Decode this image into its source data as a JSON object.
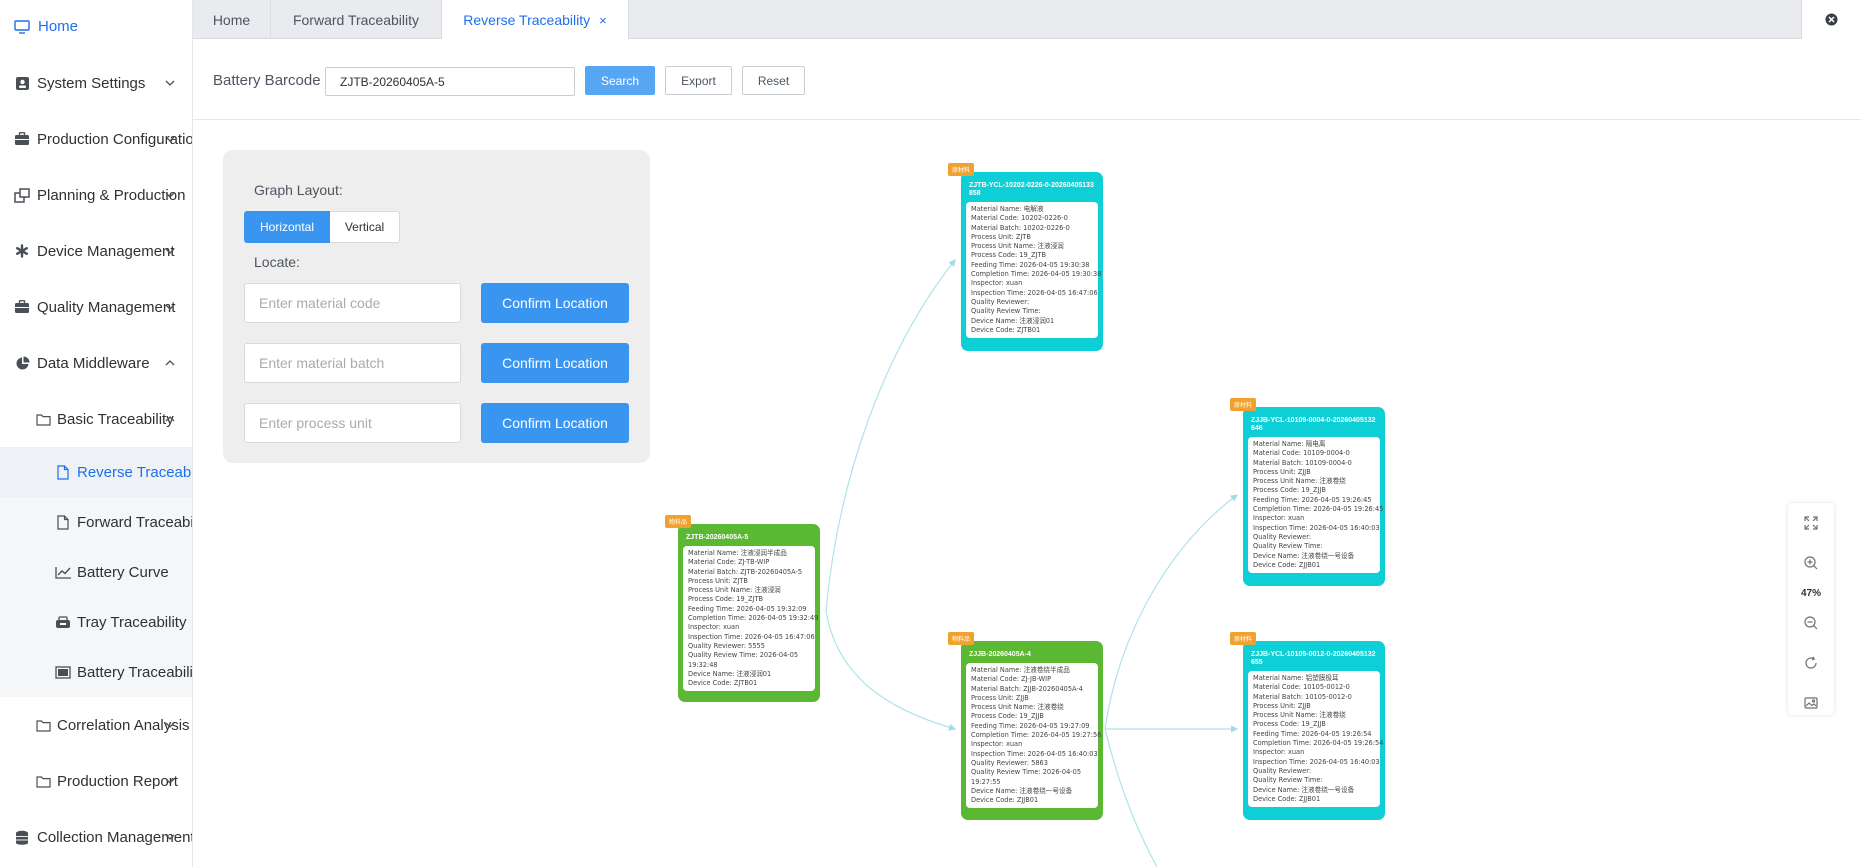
{
  "sidebar": {
    "home": "Home",
    "items": [
      {
        "label": "System Settings",
        "icon": "user-badge-icon"
      },
      {
        "label": "Production Configuration",
        "icon": "briefcase-icon"
      },
      {
        "label": "Planning & Production",
        "icon": "windows-icon"
      },
      {
        "label": "Device Management",
        "icon": "asterisk-icon"
      },
      {
        "label": "Quality Management",
        "icon": "briefcase-icon"
      },
      {
        "label": "Data Middleware",
        "icon": "pie-chart-icon"
      }
    ],
    "basic_traceability": "Basic Traceability",
    "leaves": [
      {
        "label": "Reverse Traceability",
        "active": true
      },
      {
        "label": "Forward Traceability",
        "active": false
      },
      {
        "label": "Battery Curve",
        "active": false
      },
      {
        "label": "Tray Traceability",
        "active": false
      },
      {
        "label": "Battery Traceability",
        "active": false
      }
    ],
    "correlation": "Correlation Analysis",
    "production_report": "Production Report",
    "collection": "Collection Management"
  },
  "tabs": [
    {
      "label": "Home"
    },
    {
      "label": "Forward Traceability"
    },
    {
      "label": "Reverse Traceability",
      "close": "×"
    }
  ],
  "search": {
    "label": "Battery Barcode",
    "value": "ZJTB-20260405A-5",
    "search_btn": "Search",
    "export_btn": "Export",
    "reset_btn": "Reset"
  },
  "panel": {
    "graph_layout": "Graph Layout:",
    "horizontal": "Horizontal",
    "vertical": "Vertical",
    "locate": "Locate:",
    "material_code_ph": "Enter material code",
    "material_batch_ph": "Enter material batch",
    "process_unit_ph": "Enter process unit",
    "confirm": "Confirm Location"
  },
  "zoom": {
    "percent": "47%"
  },
  "colors": {
    "accent": "#1f6feb",
    "primary_button": "#3a95f0",
    "node_raw": "#0fcfd6",
    "node_product": "#5bb832",
    "tag": "#f0a12e"
  },
  "nodes": {
    "root": {
      "tag": "物料品",
      "title": "ZJTB-20260405A-5",
      "rows": [
        "Material Name:  注液浸润半成品",
        "Material Code:  ZJ-TB-WIP",
        "Material Batch:  ZJTB-20260405A-5",
        "Process Unit:  ZJTB",
        "Process Unit Name:  注液浸润",
        "Process Code:  19_ZJTB",
        "Feeding Time:  2026-04-05 19:32:09",
        "Completion Time:  2026-04-05 19:32:49",
        "Inspector:  xuan",
        "Inspection Time:  2026-04-05 16:47:06",
        "Quality Reviewer:  5555",
        "Quality Review Time:  2026-04-05 19:32:48",
        "Device Name:  注液浸润01",
        "Device Code:  ZJTB01"
      ]
    },
    "top": {
      "tag": "原材料",
      "title": "ZJTB-YCL-10202-0226-0-20260405133858",
      "rows": [
        "Material Name:  电解液",
        "Material Code:  10202-0226-0",
        "Material Batch:  10202-0226-0",
        "Process Unit:  ZJTB",
        "Process Unit Name:  注液浸润",
        "Process Code:  19_ZJTB",
        "Feeding Time:  2026-04-05 19:30:38",
        "Completion Time:  2026-04-05 19:30:38",
        "Inspector:  xuan",
        "Inspection Time:  2026-04-05 16:47:06",
        "Quality Reviewer:",
        "Quality Review Time:",
        "Device Name:  注液浸润01",
        "Device Code:  ZJTB01"
      ]
    },
    "mid": {
      "tag": "物料品",
      "title": "ZJJB-20260405A-4",
      "rows": [
        "Material Name:  注液卷绕半成品",
        "Material Code:  ZJ-JB-WIP",
        "Material Batch:  ZJJB-20260405A-4",
        "Process Unit:  ZJJB",
        "Process Unit Name:  注液卷绕",
        "Process Code:  19_ZJJB",
        "Feeding Time:  2026-04-05 19:27:09",
        "Completion Time:  2026-04-05 19:27:56",
        "Inspector:  xuan",
        "Inspection Time:  2026-04-05 16:40:03",
        "Quality Reviewer:  5863",
        "Quality Review Time:  2026-04-05 19:27:55",
        "Device Name:  注液卷绕一号设备",
        "Device Code:  ZJJB01"
      ]
    },
    "right1": {
      "tag": "原材料",
      "title": "ZJJB-YCL-10109-0004-0-20260405132646",
      "rows": [
        "Material Name:  隔电离",
        "Material Code:  10109-0004-0",
        "Material Batch:  10109-0004-0",
        "Process Unit:  ZJJB",
        "Process Unit Name:  注液卷绕",
        "Process Code:  19_ZJJB",
        "Feeding Time:  2026-04-05 19:26:45",
        "Completion Time:  2026-04-05 19:26:45",
        "Inspector:  xuan",
        "Inspection Time:  2026-04-05 16:40:03",
        "Quality Reviewer:",
        "Quality Review Time:",
        "Device Name:  注液卷绕一号设备",
        "Device Code:  ZJJB01"
      ]
    },
    "right2": {
      "tag": "原材料",
      "title": "ZJJB-YCL-10105-0012-0-20260405132655",
      "rows": [
        "Material Name:  铝塑膜极耳",
        "Material Code:  10105-0012-0",
        "Material Batch:  10105-0012-0",
        "Process Unit:  ZJJB",
        "Process Unit Name:  注液卷绕",
        "Process Code:  19_ZJJB",
        "Feeding Time:  2026-04-05 19:26:54",
        "Completion Time:  2026-04-05 19:26:54",
        "Inspector:  xuan",
        "Inspection Time:  2026-04-05 16:40:03",
        "Quality Reviewer:",
        "Quality Review Time:",
        "Device Name:  注液卷绕一号设备",
        "Device Code:  ZJJB01"
      ]
    }
  }
}
